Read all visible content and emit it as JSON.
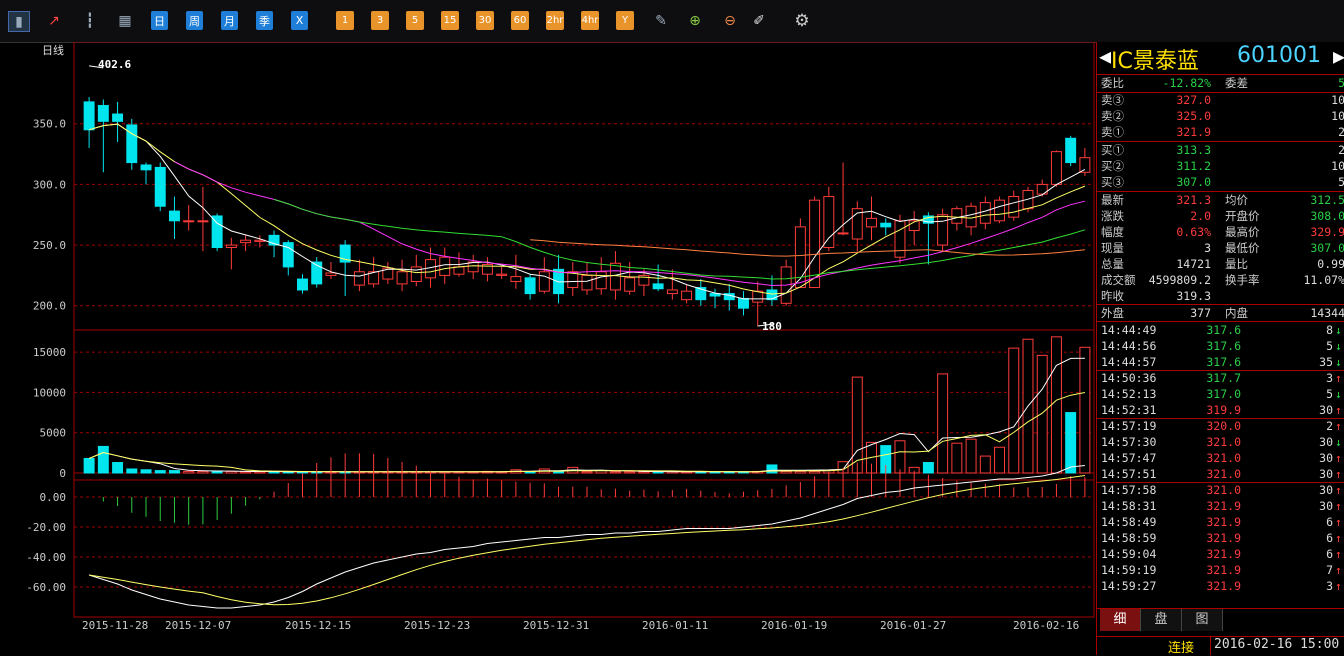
{
  "toolbar": {
    "period_buttons": [
      "日",
      "周",
      "月",
      "季",
      "X"
    ],
    "interval_buttons": [
      "1",
      "3",
      "5",
      "15",
      "30",
      "60",
      "2hr",
      "4hr",
      "Y"
    ]
  },
  "chart": {
    "period_label": "日线",
    "high_annotation": "402.6",
    "low_annotation": "180",
    "price_ticks": [
      "350.0",
      "300.0",
      "250.0",
      "200.0"
    ],
    "volume_ticks": [
      "15000",
      "10000",
      "5000",
      "0"
    ],
    "macd_ticks": [
      "0.00",
      "-20.00",
      "-40.00",
      "-60.00"
    ],
    "date_labels": [
      "2015-11-28",
      "2015-12-07",
      "2015-12-15",
      "2015-12-23",
      "2015-12-31",
      "2016-01-11",
      "2016-01-19",
      "2016-01-27",
      "2016-02-16"
    ]
  },
  "quote": {
    "name": "IC景泰蓝",
    "code": "601001",
    "weibi_label": "委比",
    "weibi_value": "-12.82%",
    "weicha_label": "委差",
    "weicha_value": "5",
    "asks": [
      {
        "label": "卖③",
        "price": "327.0",
        "vol": "10"
      },
      {
        "label": "卖②",
        "price": "325.0",
        "vol": "10"
      },
      {
        "label": "卖①",
        "price": "321.9",
        "vol": "2"
      }
    ],
    "bids": [
      {
        "label": "买①",
        "price": "313.3",
        "vol": "2"
      },
      {
        "label": "买②",
        "price": "311.2",
        "vol": "10"
      },
      {
        "label": "买③",
        "price": "307.0",
        "vol": "5"
      }
    ],
    "stats": [
      {
        "l1": "最新",
        "v1": "321.3",
        "c1": "red",
        "l2": "均价",
        "v2": "312.5",
        "c2": "green"
      },
      {
        "l1": "涨跌",
        "v1": "2.0",
        "c1": "red",
        "l2": "开盘价",
        "v2": "308.0",
        "c2": "green"
      },
      {
        "l1": "幅度",
        "v1": "0.63%",
        "c1": "red",
        "l2": "最高价",
        "v2": "329.9",
        "c2": "red"
      },
      {
        "l1": "现量",
        "v1": "3",
        "c1": "white",
        "l2": "最低价",
        "v2": "307.0",
        "c2": "green"
      },
      {
        "l1": "总量",
        "v1": "14721",
        "c1": "white",
        "l2": "量比",
        "v2": "0.99",
        "c2": "white"
      },
      {
        "l1": "成交额",
        "v1": "4599809.2",
        "c1": "white",
        "l2": "换手率",
        "v2": "11.07%",
        "c2": "white"
      },
      {
        "l1": "昨收",
        "v1": "319.3",
        "c1": "white",
        "l2": "",
        "v2": "",
        "c2": "white"
      }
    ],
    "waipan_label": "外盘",
    "waipan_value": "377",
    "neipan_label": "内盘",
    "neipan_value": "14344",
    "ticks": [
      {
        "time": "14:44:49",
        "price": "317.6",
        "vol": "8",
        "dir": "↓",
        "color": "green"
      },
      {
        "time": "14:44:56",
        "price": "317.6",
        "vol": "5",
        "dir": "↓",
        "color": "green"
      },
      {
        "time": "14:44:57",
        "price": "317.6",
        "vol": "35",
        "dir": "↓",
        "color": "green"
      },
      {
        "time": "14:50:36",
        "price": "317.7",
        "vol": "3",
        "dir": "↑",
        "color": "green"
      },
      {
        "time": "14:52:13",
        "price": "317.0",
        "vol": "5",
        "dir": "↓",
        "color": "green"
      },
      {
        "time": "14:52:31",
        "price": "319.9",
        "vol": "30",
        "dir": "↑",
        "color": "red"
      },
      {
        "time": "14:57:19",
        "price": "320.0",
        "vol": "2",
        "dir": "↑",
        "color": "red"
      },
      {
        "time": "14:57:30",
        "price": "321.0",
        "vol": "30",
        "dir": "↓",
        "color": "red"
      },
      {
        "time": "14:57:47",
        "price": "321.0",
        "vol": "30",
        "dir": "↑",
        "color": "red"
      },
      {
        "time": "14:57:51",
        "price": "321.0",
        "vol": "30",
        "dir": "↑",
        "color": "red"
      },
      {
        "time": "14:57:58",
        "price": "321.0",
        "vol": "30",
        "dir": "↑",
        "color": "red"
      },
      {
        "time": "14:58:31",
        "price": "321.9",
        "vol": "30",
        "dir": "↑",
        "color": "red"
      },
      {
        "time": "14:58:49",
        "price": "321.9",
        "vol": "6",
        "dir": "↑",
        "color": "red"
      },
      {
        "time": "14:58:59",
        "price": "321.9",
        "vol": "6",
        "dir": "↑",
        "color": "red"
      },
      {
        "time": "14:59:04",
        "price": "321.9",
        "vol": "6",
        "dir": "↑",
        "color": "red"
      },
      {
        "time": "14:59:19",
        "price": "321.9",
        "vol": "7",
        "dir": "↑",
        "color": "red"
      },
      {
        "time": "14:59:27",
        "price": "321.9",
        "vol": "3",
        "dir": "↑",
        "color": "red"
      }
    ]
  },
  "tabs": [
    "细",
    "盘",
    "图"
  ],
  "status": {
    "connection": "连接",
    "datetime": "2016-02-16 15:00"
  },
  "colors": {
    "up": "#ff3b3b",
    "down": "#00e5ee",
    "grid": "#a00000",
    "ma5": "#ffffff",
    "ma10": "#ffff66",
    "ma20": "#ff33ff",
    "ma30": "#33dd33",
    "ma60": "#ff8040"
  },
  "chart_data": {
    "type": "candlestick",
    "dates": [
      "2015-11-28",
      "2015-12-07",
      "2015-12-15",
      "2015-12-23",
      "2015-12-31",
      "2016-01-11",
      "2016-01-19",
      "2016-01-27",
      "2016-02-16"
    ],
    "ylim": [
      180,
      405
    ],
    "candles": [
      [
        368,
        345,
        372,
        330
      ],
      [
        365,
        352,
        370,
        310
      ],
      [
        358,
        352,
        368,
        335
      ],
      [
        349,
        318,
        354,
        312
      ],
      [
        316,
        312,
        318,
        300
      ],
      [
        314,
        282,
        318,
        278
      ],
      [
        278,
        270,
        290,
        255
      ],
      [
        270,
        270,
        283,
        262
      ],
      [
        270,
        270,
        298,
        245
      ],
      [
        274,
        248,
        276,
        245
      ],
      [
        248,
        250,
        256,
        230
      ],
      [
        252,
        254,
        258,
        245
      ],
      [
        253,
        254,
        258,
        248
      ],
      [
        258,
        250,
        262,
        240
      ],
      [
        252,
        232,
        254,
        225
      ],
      [
        222,
        213,
        226,
        210
      ],
      [
        236,
        218,
        240,
        215
      ],
      [
        225,
        227,
        236,
        222
      ],
      [
        250,
        236,
        254,
        208
      ],
      [
        217,
        228,
        238,
        212
      ],
      [
        218,
        228,
        240,
        215
      ],
      [
        222,
        231,
        236,
        218
      ],
      [
        218,
        228,
        238,
        212
      ],
      [
        220,
        232,
        242,
        216
      ],
      [
        223,
        238,
        248,
        215
      ],
      [
        225,
        240,
        248,
        218
      ],
      [
        226,
        232,
        244,
        224
      ],
      [
        228,
        236,
        242,
        222
      ],
      [
        226,
        234,
        240,
        220
      ],
      [
        225,
        226,
        232,
        222
      ],
      [
        220,
        224,
        242,
        214
      ],
      [
        223,
        210,
        226,
        205
      ],
      [
        212,
        228,
        240,
        210
      ],
      [
        230,
        210,
        242,
        202
      ],
      [
        215,
        228,
        236,
        208
      ],
      [
        213,
        225,
        236,
        209
      ],
      [
        214,
        228,
        240,
        209
      ],
      [
        213,
        235,
        245,
        205
      ],
      [
        212,
        223,
        236,
        209
      ],
      [
        217,
        225,
        230,
        208
      ],
      [
        218,
        214,
        234,
        212
      ],
      [
        210,
        213,
        230,
        205
      ],
      [
        205,
        212,
        218,
        202
      ],
      [
        215,
        205,
        222,
        200
      ],
      [
        210,
        208,
        214,
        198
      ],
      [
        210,
        205,
        218,
        196
      ],
      [
        206,
        198,
        212,
        192
      ],
      [
        203,
        212,
        220,
        183
      ],
      [
        213,
        205,
        225,
        200
      ],
      [
        202,
        232,
        238,
        200
      ],
      [
        215,
        265,
        272,
        215
      ],
      [
        215,
        287,
        290,
        215
      ],
      [
        248,
        290,
        298,
        245
      ],
      [
        260,
        260,
        318,
        258
      ],
      [
        255,
        280,
        286,
        245
      ],
      [
        265,
        272,
        290,
        254
      ],
      [
        268,
        265,
        272,
        258
      ],
      [
        240,
        270,
        275,
        235
      ],
      [
        262,
        270,
        278,
        250
      ],
      [
        274,
        268,
        277,
        234
      ],
      [
        250,
        275,
        280,
        245
      ],
      [
        268,
        280,
        282,
        262
      ],
      [
        265,
        282,
        285,
        258
      ],
      [
        268,
        285,
        290,
        263
      ],
      [
        270,
        287,
        290,
        268
      ],
      [
        273,
        290,
        295,
        270
      ],
      [
        280,
        295,
        298,
        277
      ],
      [
        292,
        300,
        304,
        290
      ],
      [
        300,
        327,
        328,
        298
      ],
      [
        338,
        318,
        340,
        315
      ],
      [
        310,
        322,
        330,
        307
      ]
    ],
    "volumes": [
      1800,
      3300,
      1300,
      500,
      400,
      300,
      300,
      200,
      200,
      250,
      200,
      150,
      150,
      150,
      150,
      150,
      150,
      150,
      150,
      150,
      150,
      150,
      150,
      150,
      150,
      150,
      150,
      150,
      200,
      150,
      400,
      150,
      500,
      150,
      700,
      150,
      300,
      150,
      150,
      150,
      150,
      200,
      150,
      150,
      150,
      150,
      150,
      200,
      1000,
      200,
      200,
      200,
      300,
      1400,
      11900,
      3800,
      3400,
      4000,
      700,
      1300,
      12300,
      3700,
      4200,
      2100,
      3200,
      15500,
      16600,
      14600,
      16900,
      7500,
      15600
    ],
    "macd_dif": [
      -52,
      -55,
      -58,
      -62,
      -65,
      -68,
      -70,
      -72,
      -73,
      -74,
      -74,
      -73,
      -72,
      -70,
      -67,
      -63,
      -58,
      -54,
      -50,
      -47,
      -44,
      -42,
      -40,
      -38,
      -37,
      -35,
      -34,
      -33,
      -31,
      -30,
      -29,
      -28,
      -27,
      -27,
      -26,
      -25,
      -25,
      -24,
      -24,
      -23,
      -23,
      -22,
      -21,
      -21,
      -21,
      -21,
      -20,
      -19,
      -18,
      -16,
      -14,
      -11,
      -8,
      -5,
      -1,
      1,
      3,
      4,
      6,
      7,
      8,
      9,
      10,
      11,
      12,
      12,
      13,
      14,
      16,
      20,
      21
    ]
  }
}
